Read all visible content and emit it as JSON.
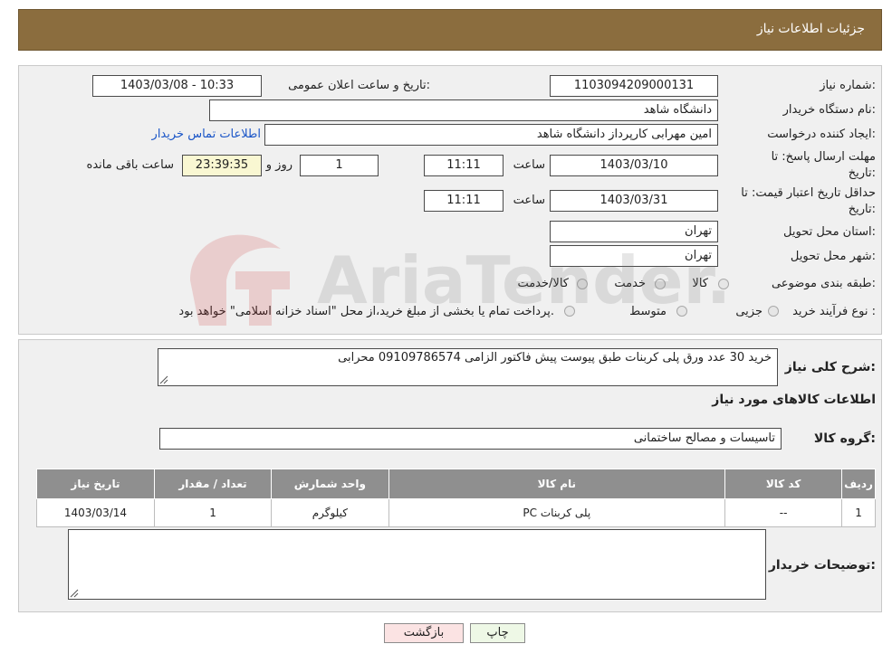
{
  "header": {
    "title": "جزئیات اطلاعات نیاز"
  },
  "info": {
    "need_number_label": "شماره نیاز:",
    "need_number": "1103094209000131",
    "announce_label": "تاریخ و ساعت اعلان عمومی:",
    "announce_value": "1403/03/08 - 10:33",
    "buyer_org_label": "نام دستگاه خریدار:",
    "buyer_org": "دانشگاه شاهد",
    "creator_label": "ایجاد کننده درخواست:",
    "creator": "امین مهرابی کارپرداز دانشگاه شاهد",
    "contact_link": "اطلاعات تماس خریدار",
    "reply_deadline_label_1": "مهلت ارسال پاسخ: تا",
    "reply_deadline_label_2": "تاریخ:",
    "reply_date": "1403/03/10",
    "time_label": "ساعت",
    "reply_time": "11:11",
    "days_value": "1",
    "days_label": "روز و",
    "remaining_time": "23:39:35",
    "remaining_label": "ساعت باقی مانده",
    "price_validity_label_1": "حداقل تاریخ اعتبار قیمت: تا",
    "price_validity_label_2": "تاریخ:",
    "price_date": "1403/03/31",
    "price_time": "11:11",
    "province_label": "استان محل تحویل:",
    "province": "تهران",
    "city_label": "شهر محل تحویل:",
    "city": "تهران",
    "category_label": "طبقه بندی موضوعی:",
    "category_options": [
      "کالا",
      "خدمت",
      "کالا/خدمت"
    ],
    "process_label": "نوع فرآیند خرید :",
    "process_options": [
      "جزیی",
      "متوسط"
    ],
    "process_note": "پرداخت تمام یا بخشی از مبلغ خرید،از محل \"اسناد خزانه اسلامی\" خواهد بود."
  },
  "details": {
    "description_label": "شرح کلی نیاز:",
    "description": "خرید 30 عدد ورق پلی کربنات طبق پیوست پیش فاکتور الزامی 09109786574 محرابی",
    "goods_info_title": "اطلاعات کالاهای مورد نیاز",
    "goods_group_label": "گروه کالا:",
    "goods_group": "تاسیسات و مصالح ساختمانی",
    "table": {
      "headers": [
        "ردیف",
        "کد کالا",
        "نام کالا",
        "واحد شمارش",
        "تعداد / مقدار",
        "تاریخ نیاز"
      ],
      "rows": [
        [
          "1",
          "--",
          "پلی کربنات PC",
          "کیلوگرم",
          "1",
          "1403/03/14"
        ]
      ]
    },
    "buyer_notes_label": "توضیحات خریدار:",
    "buyer_notes": ""
  },
  "buttons": {
    "print": "چاپ",
    "back": "بازگشت"
  },
  "watermark": {
    "text": "AriaTender.neT"
  },
  "colors": {
    "header_bg": "#8b6d3e",
    "link": "#1a55c7",
    "back_button_bg": "#fbe3e3",
    "print_button_bg": "#eef8e6",
    "timer_bg": "#f9f7d2"
  }
}
